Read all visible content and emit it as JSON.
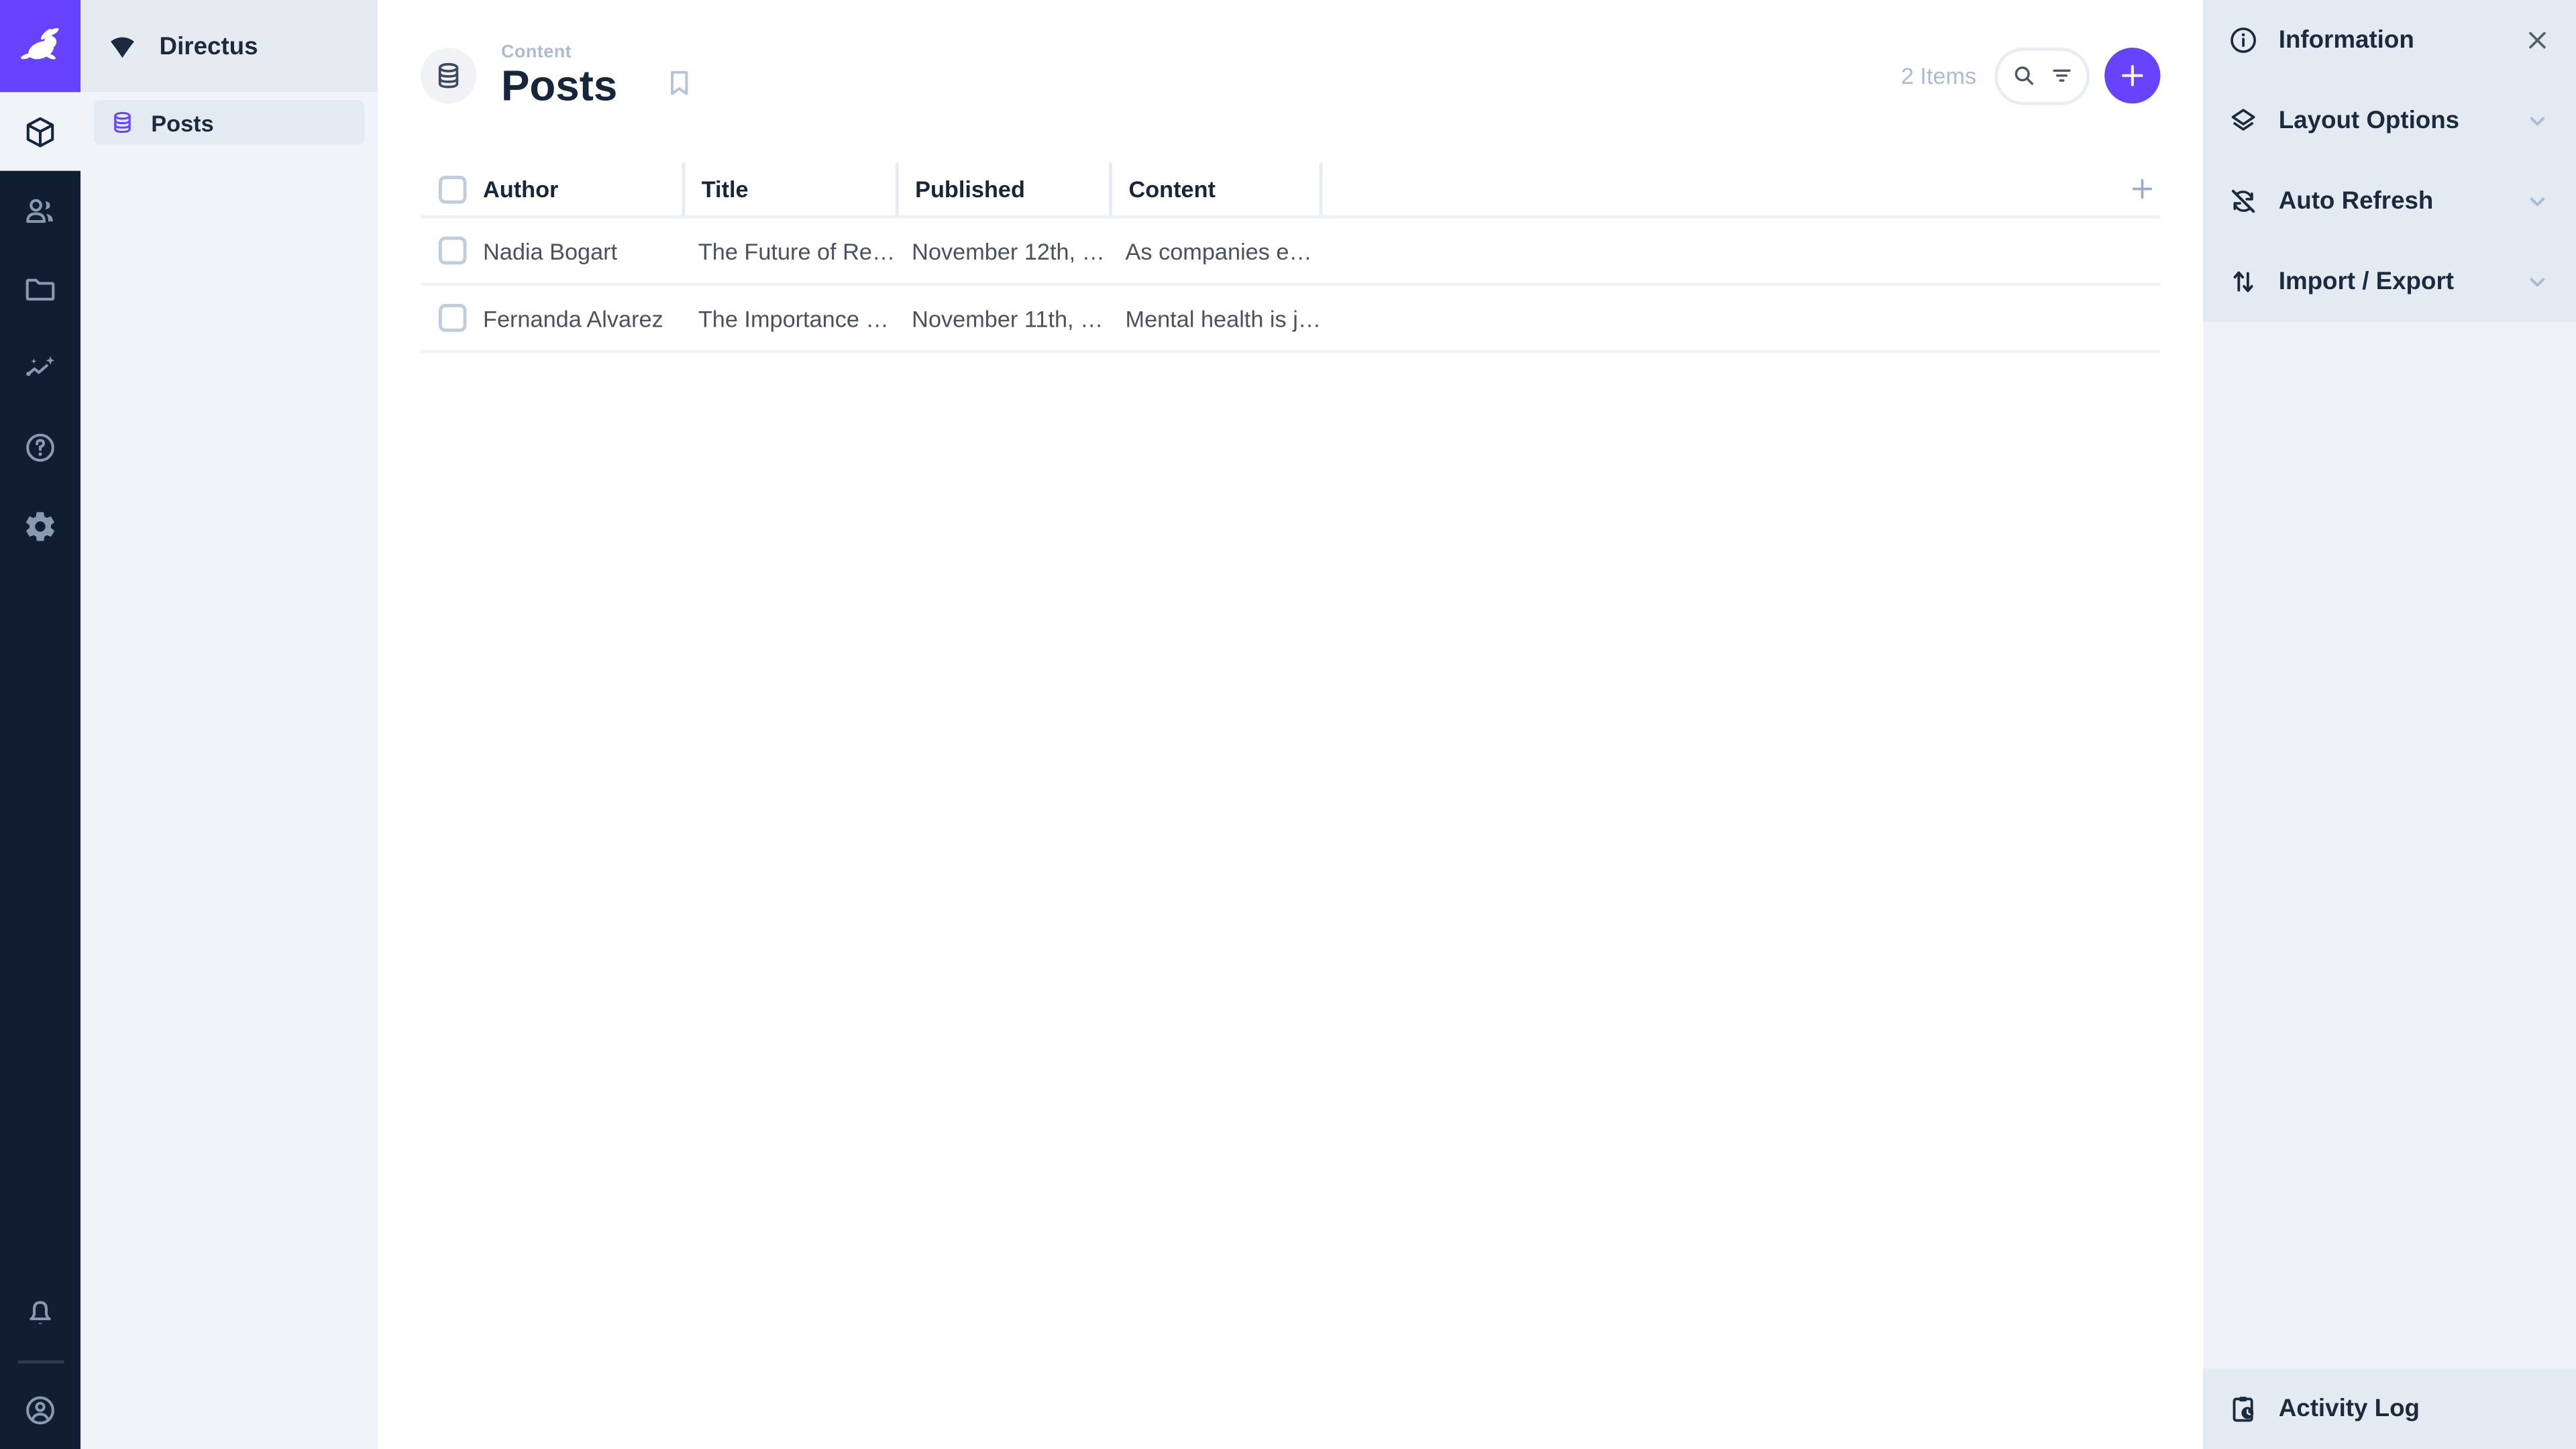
{
  "colors": {
    "accent": "#6644FF",
    "module_bar_bg": "#111E31",
    "nav_bg": "#F0F4F9",
    "sidebar_section_bg": "#E4EAF1",
    "text_dark": "#16263B",
    "text_muted": "#A9BCD3",
    "text_cell": "#4A5260"
  },
  "module_bar": {
    "logo_icon": "directus-rabbit-logo",
    "modules": [
      {
        "name": "content",
        "icon": "box-icon",
        "active": true
      },
      {
        "name": "users",
        "icon": "people-icon",
        "active": false
      },
      {
        "name": "files",
        "icon": "folder-icon",
        "active": false
      },
      {
        "name": "insights",
        "icon": "insights-icon",
        "active": false
      },
      {
        "name": "docs",
        "icon": "help-icon",
        "active": false
      },
      {
        "name": "settings",
        "icon": "gear-icon",
        "active": false
      }
    ],
    "bottom": [
      {
        "name": "notifications",
        "icon": "bell-icon"
      },
      {
        "name": "account",
        "icon": "user-circle-icon"
      }
    ]
  },
  "nav": {
    "project_name": "Directus",
    "project_icon": "wifi-fan-icon",
    "items": [
      {
        "label": "Posts",
        "icon": "database-icon",
        "active": true
      }
    ]
  },
  "header": {
    "collection_icon": "database-icon",
    "breadcrumb": "Content",
    "title": "Posts",
    "bookmark_icon": "bookmark-icon",
    "item_count": "2 Items",
    "search_icon": "search-icon",
    "filter_icon": "filter-icon",
    "add_icon": "plus-icon"
  },
  "table": {
    "columns": {
      "author": "Author",
      "title": "Title",
      "published": "Published",
      "content": "Content"
    },
    "add_column_icon": "plus-icon",
    "rows": [
      {
        "author": "Nadia Bogart",
        "title": "The Future of Re…",
        "published": "November 12th, …",
        "content": "As companies e…"
      },
      {
        "author": "Fernanda Alvarez",
        "title": "The Importance …",
        "published": "November 11th, …",
        "content": "Mental health is j…"
      }
    ]
  },
  "sidebar": {
    "sections": [
      {
        "label": "Information",
        "icon": "info-icon",
        "control": "close-icon"
      },
      {
        "label": "Layout Options",
        "icon": "layers-icon",
        "control": "chevron-down-icon"
      },
      {
        "label": "Auto Refresh",
        "icon": "sync-disabled-icon",
        "control": "chevron-down-icon"
      },
      {
        "label": "Import / Export",
        "icon": "import-export-icon",
        "control": "chevron-down-icon"
      }
    ],
    "activity_log": {
      "label": "Activity Log",
      "icon": "activity-log-icon"
    }
  }
}
